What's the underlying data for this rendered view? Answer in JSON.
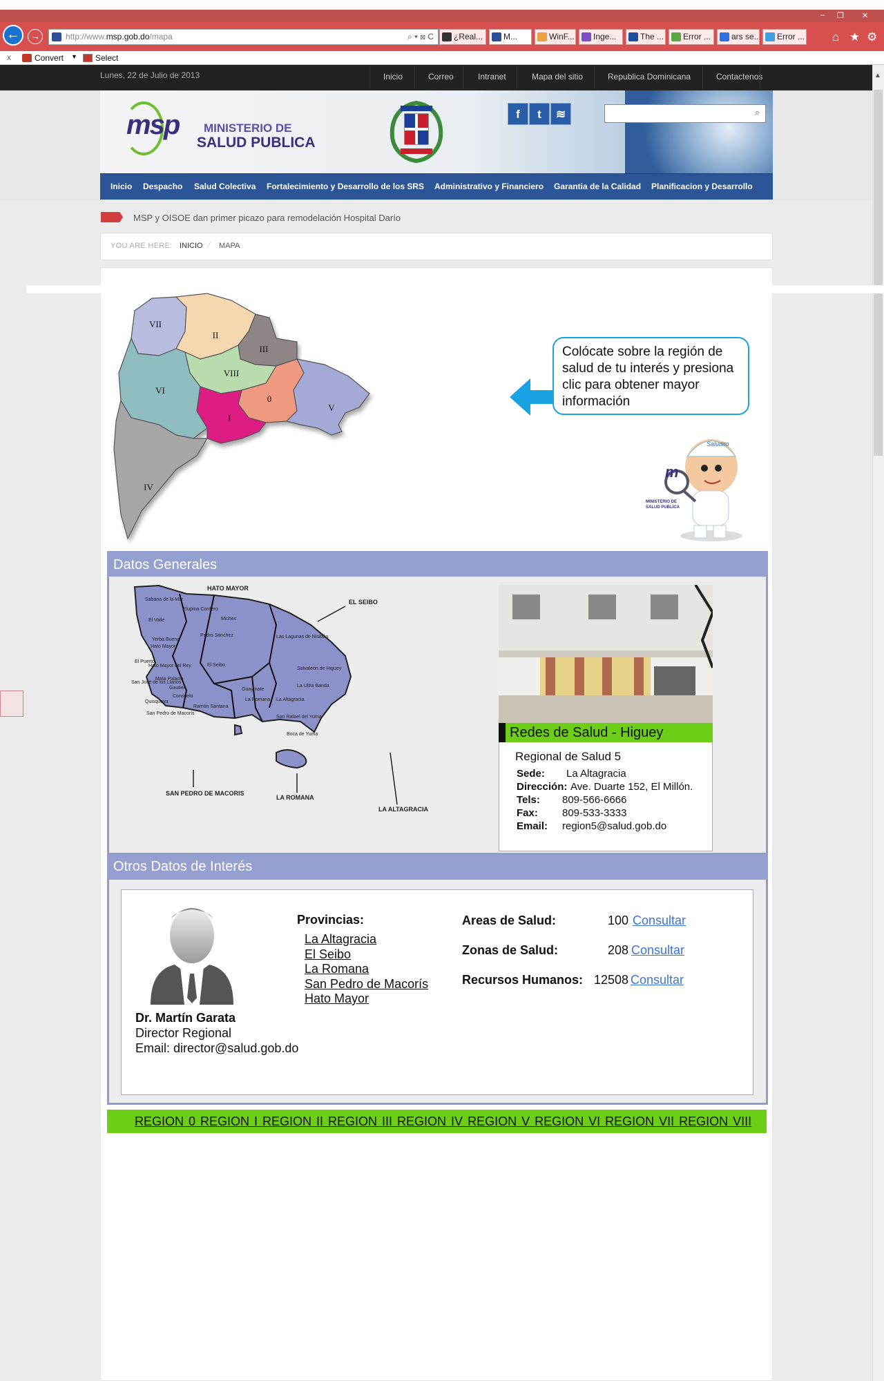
{
  "browser": {
    "url_prefix": "http://www.",
    "url_domain": "msp.gob.do",
    "url_path": "/mapa",
    "url_tools": "⌕ ▾ ⊠ C",
    "tabs": [
      {
        "label": "¿Real...",
        "color": "#333"
      },
      {
        "label": "M...",
        "color": "#2d4e9a"
      },
      {
        "label": "WinF...",
        "color": "#e8a33c"
      },
      {
        "label": "Inge...",
        "color": "#7a4fc2"
      },
      {
        "label": "The ...",
        "color": "#1a4f9e"
      },
      {
        "label": "Error ...",
        "color": "#5aa845"
      },
      {
        "label": "ars se...",
        "color": "#2f6fe0"
      },
      {
        "label": "Error ...",
        "color": "#3aa0e0"
      }
    ],
    "cmd_convert": "Convert",
    "cmd_select": "Select",
    "cmd_close": "x"
  },
  "site": {
    "date": "Lunes, 22 de Julio de 2013",
    "top_links": [
      "Inicio",
      "Correo",
      "Intranet",
      "Mapa del sitio",
      "Republica Dominicana",
      "Contactenos"
    ],
    "logo_text": "msp",
    "ministry_line1": "MINISTERIO DE",
    "ministry_line2": "SALUD PUBLICA",
    "social": [
      "f",
      "t",
      "≋"
    ],
    "search_icon": "magnifier-icon",
    "nav": [
      "Inicio",
      "Despacho",
      "Salud Colectiva",
      "Fortalecimiento y Desarrollo de los SRS",
      "Administrativo y Financiero",
      "Garantia de la Calidad",
      "Planificacion y Desarrollo"
    ],
    "ticker": "MSP y OISOE dan primer picazo para remodelación Hospital Darío",
    "breadcrumb_label": "YOU ARE HERE:",
    "breadcrumb": [
      "INICIO",
      "MAPA"
    ],
    "breadcrumb_sep": "⁄"
  },
  "map": {
    "bubble": "Colócate sobre la región de salud de tu interés y presiona clic para obtener mayor información",
    "regions": [
      {
        "label": "VII",
        "color": "#b8bde0"
      },
      {
        "label": "II",
        "color": "#f5d8b0"
      },
      {
        "label": "III",
        "color": "#8e8686"
      },
      {
        "label": "VIII",
        "color": "#b9dcae"
      },
      {
        "label": "VI",
        "color": "#8fbcbf"
      },
      {
        "label": "0",
        "color": "#ef9a80"
      },
      {
        "label": "V",
        "color": "#a4a9d6"
      },
      {
        "label": "I",
        "color": "#dd1d84"
      },
      {
        "label": "IV",
        "color": "#a6a6a6"
      }
    ],
    "mascot_badge": "Saludito",
    "mascot_logo_line1": "MINISTERIO DE",
    "mascot_logo_line2": "SALUD PUBLICA"
  },
  "datos": {
    "heading": "Datos Generales",
    "map_labels": [
      "HATO MAYOR",
      "EL SEIBO",
      "SAN PEDRO DE MACORIS",
      "LA ROMANA",
      "LA ALTAGRACIA"
    ],
    "municipios": [
      "Sabana de la Mar",
      "Elupina Cordero",
      "El Valle",
      "Miches",
      "Pedro Sánchez",
      "Las Lagunas de Nisibón",
      "Yerba Buena",
      "Hato Mayor",
      "El Puerto",
      "Hato Mayor del Rey",
      "El Seibo",
      "Salvaleón de Higuey",
      "Mata Palacio",
      "San José de los Llanos",
      "La Ultra Banda",
      "Gautier",
      "Quisqueya",
      "San Pedro de Macorís",
      "Consuelo",
      "Ramón Santana",
      "Guaymate",
      "La Romana",
      "La Altagracia",
      "San Rafael del Yuma",
      "Boca de Yuma"
    ],
    "caption": "Redes de Salud - Higuey",
    "info_title": "Regional de Salud 5",
    "fields": [
      {
        "label": "Sede:",
        "value": "La Altagracia"
      },
      {
        "label": "Dirección:",
        "value": "Ave. Duarte  152, El Millón."
      },
      {
        "label": "Tels:",
        "value": "809-566-6666"
      },
      {
        "label": "Fax:",
        "value": "809-533-3333"
      },
      {
        "label": "Email:",
        "value": "region5@salud.gob.do"
      }
    ]
  },
  "otros": {
    "heading": "Otros Datos de Interés",
    "director_name": "Dr. Martín Garata",
    "director_title": "Director Regional",
    "director_email": "Email: director@salud.gob.do",
    "provinces_title": "Provincias:",
    "provinces": [
      "La Altagracia",
      "El Seibo",
      "La Romana",
      "San Pedro de Macorís",
      "Hato Mayor"
    ],
    "stats": [
      {
        "label": "Areas de Salud:",
        "value": "100",
        "link": "Consultar"
      },
      {
        "label": "Zonas de Salud:",
        "value": "208",
        "link": "Consultar"
      },
      {
        "label": "Recursos Humanos:",
        "value": "12508",
        "link": "Consultar"
      }
    ]
  },
  "regions_links": "REGION 0  REGION I  REGION II REGION III REGION IV REGION V REGION VI REGION VII REGION VIII"
}
